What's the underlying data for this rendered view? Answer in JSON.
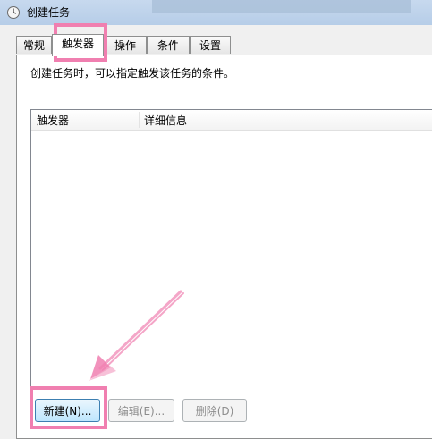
{
  "window": {
    "title": "创建任务",
    "icon": "task-scheduler-icon"
  },
  "tabs": [
    {
      "label": "常规"
    },
    {
      "label": "触发器",
      "active": true
    },
    {
      "label": "操作"
    },
    {
      "label": "条件"
    },
    {
      "label": "设置"
    }
  ],
  "description": "创建任务时，可以指定触发该任务的条件。",
  "triggers_list": {
    "columns": [
      "触发器",
      "详细信息"
    ],
    "rows": []
  },
  "buttons": {
    "new_label": "新建(N)...",
    "edit_label": "编辑(E)...",
    "delete_label": "删除(D)"
  },
  "annotations": {
    "highlight_color": "#f07fb0",
    "icon": "pink-arrow-icon"
  }
}
